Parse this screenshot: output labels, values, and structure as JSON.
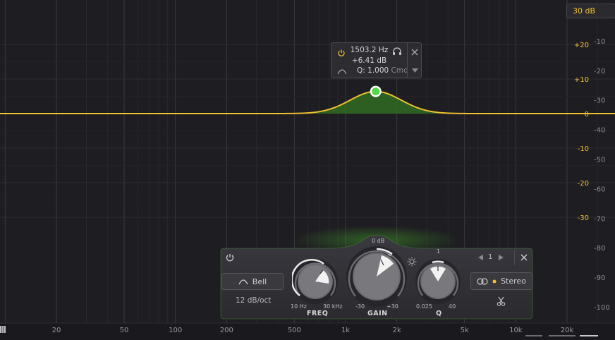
{
  "range_button": {
    "label": "30 dB"
  },
  "band_tooltip": {
    "freq": "1503.2 Hz",
    "gain": "+6.41 dB",
    "q": "Q: 1.000",
    "modifier": "Cmd"
  },
  "eq": {
    "freq_ticks": [
      "20",
      "50",
      "100",
      "200",
      "500",
      "1k",
      "2k",
      "5k",
      "10k",
      "20k"
    ],
    "freq_values": [
      20,
      50,
      100,
      200,
      500,
      1000,
      2000,
      5000,
      10000,
      20000
    ],
    "gain_scale": [
      "+20",
      "+10",
      "0",
      "-10",
      "-20",
      "-30"
    ],
    "spectrum_scale": [
      "0",
      "-10",
      "-20",
      "-30",
      "-40",
      "-50",
      "-60",
      "-70",
      "-80",
      "-90",
      "-100"
    ],
    "range_db": 30,
    "band": {
      "freq_hz": 1503.2,
      "gain_db": 6.41,
      "q": 1.0
    },
    "colors": {
      "curve": "#f0c030",
      "fill": "#2f6b21",
      "node": "#58d64a",
      "accent": "#f0c030"
    }
  },
  "band_panel": {
    "shape_label": "Bell",
    "slope_label": "12 dB/oct",
    "freq": {
      "label": "FREQ",
      "min": "10 Hz",
      "max": "30 kHz"
    },
    "gain": {
      "label": "GAIN",
      "min": "-30",
      "max": "+30",
      "center": "0 dB"
    },
    "q": {
      "label": "Q",
      "min": "0.025",
      "max": "40",
      "center": "1"
    },
    "band_number": "1",
    "stereo_label": "Stereo"
  }
}
